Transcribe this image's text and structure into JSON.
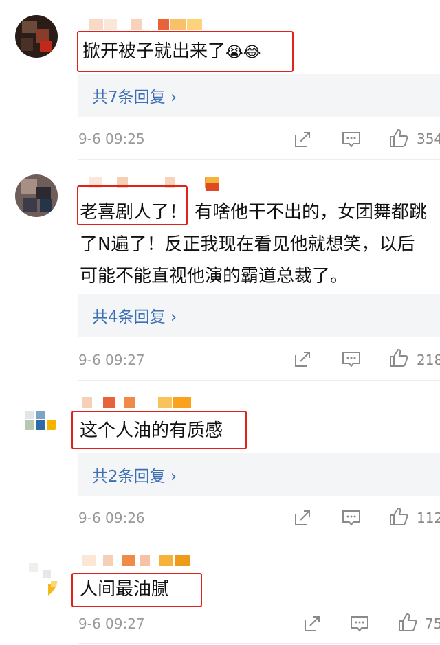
{
  "comments": [
    {
      "content": "掀开被子就出来了",
      "emoji": [
        "😭",
        "😂"
      ],
      "replies_label": "共7条回复",
      "time": "9-6 09:25",
      "likes": "354"
    },
    {
      "content_highlight": "老喜剧人了！",
      "content_rest_line1": "有啥他干不出的，女团舞都跳",
      "content_line2": "了N遍了！反正我现在看见他就想笑，以后",
      "content_line3": "可能不能直视他演的霸道总裁了。",
      "replies_label": "共4条回复",
      "time": "9-6 09:27",
      "likes": "218"
    },
    {
      "content": "这个人油的有质感",
      "replies_label": "共2条回复",
      "time": "9-6 09:26",
      "likes": "112"
    },
    {
      "content": "人间最油腻",
      "time": "9-6 09:27",
      "likes": "75"
    }
  ],
  "colors": {
    "highlight_border": "#e0221a",
    "reply_link": "#3d6fb5",
    "reply_bg": "#f4f5f7",
    "meta_text": "#999999"
  },
  "icons": [
    "share-icon",
    "comment-icon",
    "like-icon"
  ]
}
